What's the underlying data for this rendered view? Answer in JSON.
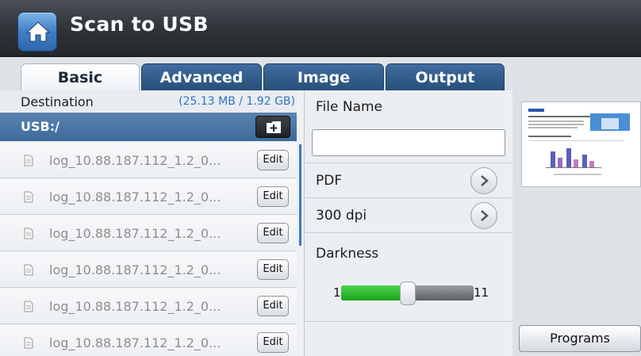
{
  "header": {
    "title": "Scan to USB"
  },
  "tabs": [
    {
      "label": "Basic",
      "active": true
    },
    {
      "label": "Advanced",
      "active": false
    },
    {
      "label": "Image",
      "active": false
    },
    {
      "label": "Output",
      "active": false
    }
  ],
  "left": {
    "destination_label": "Destination",
    "storage_info": "(25.13 MB / 1.92 GB)",
    "usb_path": "USB:/",
    "add_folder_icon": "add-folder-icon",
    "files": [
      {
        "name": "log_10.88.187.112_1.2_0...",
        "action": "Edit"
      },
      {
        "name": "log_10.88.187.112_1.2_0...",
        "action": "Edit"
      },
      {
        "name": "log_10.88.187.112_1.2_0...",
        "action": "Edit"
      },
      {
        "name": "log_10.88.187.112_1.2_0...",
        "action": "Edit"
      },
      {
        "name": "log_10.88.187.112_1.2_0...",
        "action": "Edit"
      },
      {
        "name": "log_10.88.187.112_1.2_0...",
        "action": "Edit"
      }
    ]
  },
  "middle": {
    "file_name_label": "File Name",
    "file_name_value": "",
    "format": "PDF",
    "resolution": "300 dpi",
    "darkness_label": "Darkness",
    "darkness_min": "1",
    "darkness_max": "11",
    "darkness_value": 6
  },
  "right": {
    "programs_label": "Programs"
  },
  "colors": {
    "accent": "#3d6a9c",
    "slider_fill": "#17a417",
    "highlight": "#2d73c4"
  }
}
